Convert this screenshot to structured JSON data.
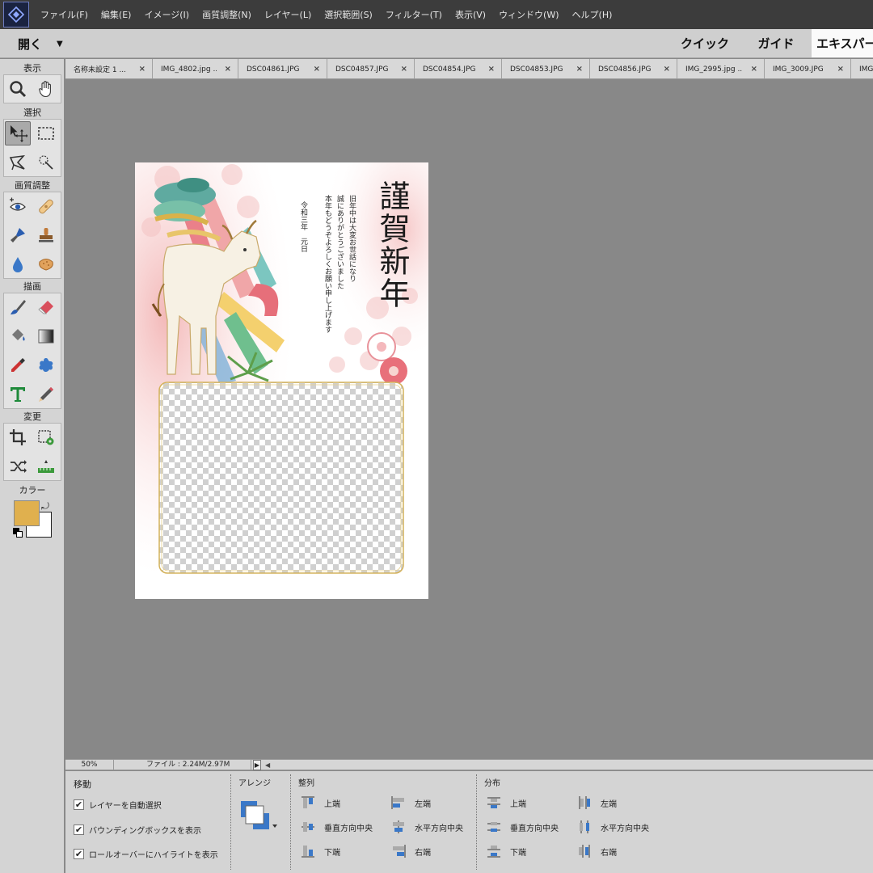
{
  "menubar": {
    "items": [
      "ファイル(F)",
      "編集(E)",
      "イメージ(I)",
      "画質調整(N)",
      "レイヤー(L)",
      "選択範囲(S)",
      "フィルター(T)",
      "表示(V)",
      "ウィンドウ(W)",
      "ヘルプ(H)"
    ]
  },
  "modebar": {
    "open_label": "開く",
    "tabs": [
      "クイック",
      "ガイド",
      "エキスパート"
    ]
  },
  "toolbox": {
    "categories": {
      "view": "表示",
      "select": "選択",
      "enhance": "画質調整",
      "draw": "描画",
      "modify": "変更",
      "color": "カラー"
    },
    "foreground_color": "#e0b04e",
    "background_color": "#ffffff"
  },
  "doc_tabs": [
    "名称未設定 1 ...",
    "IMG_4802.jpg ...",
    "DSC04861.JPG",
    "DSC04857.JPG",
    "DSC04854.JPG",
    "DSC04853.JPG",
    "DSC04856.JPG",
    "IMG_2995.jpg ...",
    "IMG_3009.JPG",
    "IMG"
  ],
  "card": {
    "title": "謹賀新年",
    "message": "旧年中は大変お世話になり\n誠にありがとうございました\n本年もどうぞよろしくお願い申し上げます",
    "date": "令和三年　元日"
  },
  "statusbar": {
    "zoom": "50%",
    "file_info": "ファイル : 2.24M/2.97M"
  },
  "options": {
    "move_title": "移動",
    "checkboxes": [
      "レイヤーを自動選択",
      "バウンディングボックスを表示",
      "ロールオーバーにハイライトを表示"
    ],
    "arrange_title": "アレンジ",
    "align_title": "整列",
    "align_items": [
      "上端",
      "垂直方向中央",
      "下端",
      "左端",
      "水平方向中央",
      "右端"
    ],
    "distribute_title": "分布",
    "distribute_items": [
      "上端",
      "垂直方向中央",
      "下端",
      "左端",
      "水平方向中央",
      "右端"
    ]
  }
}
